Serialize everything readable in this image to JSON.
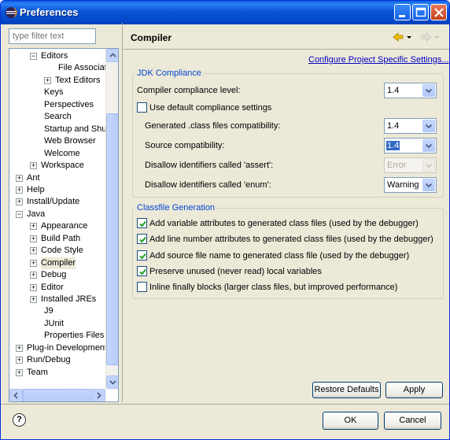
{
  "window": {
    "title": "Preferences"
  },
  "sidebar": {
    "filter_placeholder": "type filter text",
    "items": [
      {
        "label": "Editors",
        "level": 1,
        "expander": "−"
      },
      {
        "label": "File Associatio",
        "level": 2,
        "expander": ""
      },
      {
        "label": "Text Editors",
        "level": 2,
        "expander": "+"
      },
      {
        "label": "Keys",
        "level": 1,
        "expander": ""
      },
      {
        "label": "Perspectives",
        "level": 1,
        "expander": ""
      },
      {
        "label": "Search",
        "level": 1,
        "expander": ""
      },
      {
        "label": "Startup and Shutd",
        "level": 1,
        "expander": ""
      },
      {
        "label": "Web Browser",
        "level": 1,
        "expander": ""
      },
      {
        "label": "Welcome",
        "level": 1,
        "expander": ""
      },
      {
        "label": "Workspace",
        "level": 1,
        "expander": "+"
      },
      {
        "label": "Ant",
        "level": 0,
        "expander": "+"
      },
      {
        "label": "Help",
        "level": 0,
        "expander": "+"
      },
      {
        "label": "Install/Update",
        "level": 0,
        "expander": "+"
      },
      {
        "label": "Java",
        "level": 0,
        "expander": "−"
      },
      {
        "label": "Appearance",
        "level": 1,
        "expander": "+"
      },
      {
        "label": "Build Path",
        "level": 1,
        "expander": "+"
      },
      {
        "label": "Code Style",
        "level": 1,
        "expander": "+"
      },
      {
        "label": "Compiler",
        "level": 1,
        "expander": "+",
        "selected": true
      },
      {
        "label": "Debug",
        "level": 1,
        "expander": "+"
      },
      {
        "label": "Editor",
        "level": 1,
        "expander": "+"
      },
      {
        "label": "Installed JREs",
        "level": 1,
        "expander": "+"
      },
      {
        "label": "J9",
        "level": 1,
        "expander": ""
      },
      {
        "label": "JUnit",
        "level": 1,
        "expander": ""
      },
      {
        "label": "Properties Files Ed",
        "level": 1,
        "expander": ""
      },
      {
        "label": "Plug-in Development",
        "level": 0,
        "expander": "+"
      },
      {
        "label": "Run/Debug",
        "level": 0,
        "expander": "+"
      },
      {
        "label": "Team",
        "level": 0,
        "expander": "+"
      }
    ]
  },
  "main": {
    "title": "Compiler",
    "configure_link": "Configure Project Specific Settings...",
    "jdk": {
      "group_title": "JDK Compliance",
      "compliance_label": "Compiler compliance level:",
      "compliance_value": "1.4",
      "use_default_label": "Use default compliance settings",
      "use_default_checked": false,
      "class_compat_label": "Generated .class files compatibility:",
      "class_compat_value": "1.4",
      "source_compat_label": "Source compatibility:",
      "source_compat_value": "1.4",
      "assert_label": "Disallow identifiers called 'assert':",
      "assert_value": "Error",
      "enum_label": "Disallow identifiers called 'enum':",
      "enum_value": "Warning"
    },
    "classfile": {
      "group_title": "Classfile Generation",
      "options": [
        {
          "label": "Add variable attributes to generated class files (used by the debugger)",
          "checked": true
        },
        {
          "label": "Add line number attributes to generated class files (used by the debugger)",
          "checked": true
        },
        {
          "label": "Add source file name to generated class file (used by the debugger)",
          "checked": true
        },
        {
          "label": "Preserve unused (never read) local variables",
          "checked": true
        },
        {
          "label": "Inline finally blocks (larger class files, but improved performance)",
          "checked": false
        }
      ]
    },
    "restore_defaults_label": "Restore Defaults",
    "apply_label": "Apply"
  },
  "footer": {
    "help_glyph": "?",
    "ok_label": "OK",
    "cancel_label": "Cancel"
  }
}
